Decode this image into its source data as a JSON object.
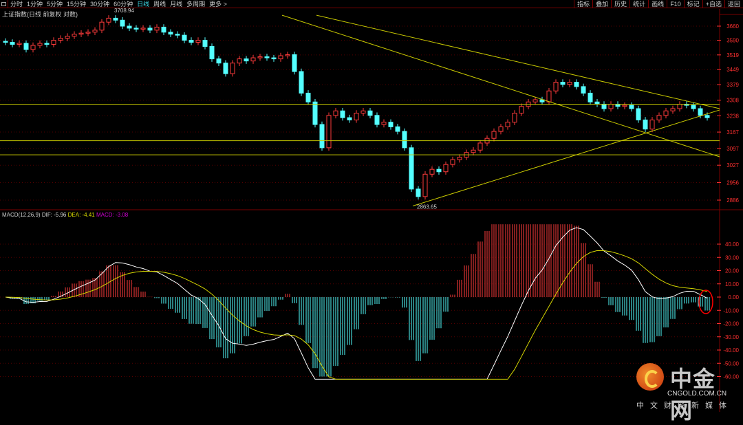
{
  "toolbar": {
    "periods": [
      "分时",
      "1分钟",
      "5分钟",
      "15分钟",
      "30分钟",
      "60分钟",
      "日线",
      "周线",
      "月线",
      "多周期",
      "更多 >"
    ],
    "active": "日线",
    "buttons": [
      "指标",
      "叠加",
      "历史",
      "统计",
      "画线",
      "F10",
      "标记",
      "+自选",
      "返回"
    ]
  },
  "title": "上证指数(日线 前复权 对数)",
  "macd_title": {
    "name": "MACD(12,26,9)",
    "dif": "DIF: -5.96",
    "dea": "DEA: -4.41",
    "macd": "MACD: -3.08"
  },
  "colors": {
    "up": "#ff3b3b",
    "down": "#54ffff",
    "dif": "#ffffff",
    "dea": "#d6d600",
    "grid": "#7a0000",
    "axis": "#ff3030",
    "macd_label": "#d000d0"
  },
  "logo": {
    "name": "中金网",
    "url_text": "CNGOLD.COM.CN",
    "tagline": "中文财经新媒体"
  },
  "chart_data": [
    {
      "type": "candlestick",
      "title": "上证指数(日线 前复权 对数)",
      "yscale": "log",
      "ylim": [
        2830,
        3760
      ],
      "yticks": [
        "3660",
        "3590",
        "3519",
        "3449",
        "3379",
        "3308",
        "3238",
        "3167",
        "3097",
        "3027",
        "2956",
        "2886"
      ],
      "annotations": [
        {
          "text": "3708.94",
          "index": 15
        },
        {
          "text": "2863.65",
          "index": 59
        }
      ],
      "closes": [
        3580,
        3570,
        3575,
        3545,
        3565,
        3575,
        3570,
        3590,
        3600,
        3610,
        3620,
        3625,
        3630,
        3640,
        3680,
        3700,
        3690,
        3660,
        3650,
        3645,
        3650,
        3640,
        3655,
        3630,
        3620,
        3615,
        3590,
        3580,
        3590,
        3560,
        3500,
        3480,
        3430,
        3480,
        3500,
        3490,
        3505,
        3510,
        3505,
        3500,
        3515,
        3520,
        3440,
        3340,
        3300,
        3200,
        3100,
        3240,
        3260,
        3230,
        3220,
        3250,
        3260,
        3240,
        3200,
        3210,
        3190,
        3170,
        3100,
        2930,
        2900,
        2990,
        3010,
        3000,
        3030,
        3050,
        3060,
        3080,
        3090,
        3120,
        3140,
        3170,
        3190,
        3210,
        3250,
        3280,
        3300,
        3310,
        3300,
        3350,
        3390,
        3380,
        3390,
        3370,
        3340,
        3300,
        3290,
        3270,
        3290,
        3280,
        3285,
        3270,
        3220,
        3180,
        3220,
        3240,
        3260,
        3270,
        3290,
        3285,
        3270,
        3240,
        3230
      ],
      "hlines": [
        3290,
        3130,
        3070
      ],
      "trendlines": [
        [
          40.2,
          3715,
          103.8,
          3062
        ],
        [
          45.2,
          3715,
          103.8,
          3270
        ],
        [
          59.2,
          2863,
          103.8,
          3264
        ]
      ]
    },
    {
      "type": "macd",
      "params": [
        12,
        26,
        9
      ],
      "ylim": [
        -65,
        60
      ],
      "yticks": [
        "40.00",
        "30.00",
        "20.00",
        "10.00",
        "0.00",
        "-10.00",
        "-20.00",
        "-30.00",
        "-40.00",
        "-50.00",
        "-60.00"
      ],
      "dif": -5.96,
      "dea": -4.41,
      "macd": -3.08
    }
  ]
}
